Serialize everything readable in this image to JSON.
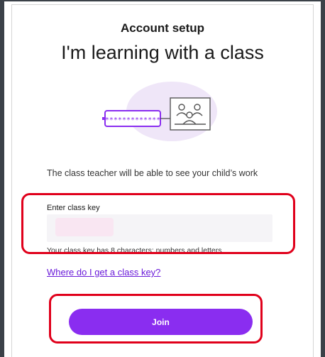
{
  "header": {
    "subtitle": "Account setup",
    "title": "I'm learning with a class"
  },
  "illustration": {
    "key_icon": "class-key-icon",
    "classroom_icon": "classroom-icon",
    "colors": {
      "accent": "#8a2df0",
      "blob": "#efe6f8"
    }
  },
  "description": "The class teacher will be able to see your child’s work",
  "class_key": {
    "label": "Enter class key",
    "value": "",
    "helper": "Your class key has 8 characters: numbers and letters"
  },
  "help_link": "Where do I get a class key?",
  "join_button": "Join",
  "colors": {
    "highlight": "#e0001b",
    "button": "#8a2df0",
    "link": "#6a1bd9"
  }
}
